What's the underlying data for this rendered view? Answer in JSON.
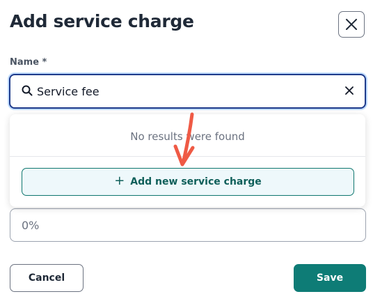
{
  "dialog": {
    "title": "Add service charge",
    "close_icon": "close-icon"
  },
  "name_field": {
    "label": "Name *",
    "value": "Service fee",
    "search_icon": "search-icon",
    "clear_icon": "clear-icon"
  },
  "dropdown": {
    "empty_message": "No results were found",
    "add_new_label": "Add new service charge",
    "add_icon": "plus-icon"
  },
  "percentage_field": {
    "placeholder": "0%"
  },
  "footer": {
    "cancel_label": "Cancel",
    "save_label": "Save"
  },
  "colors": {
    "primary": "#0e7c76",
    "focus_border": "#1e3a8a",
    "annotation_arrow": "#ef5a45"
  }
}
